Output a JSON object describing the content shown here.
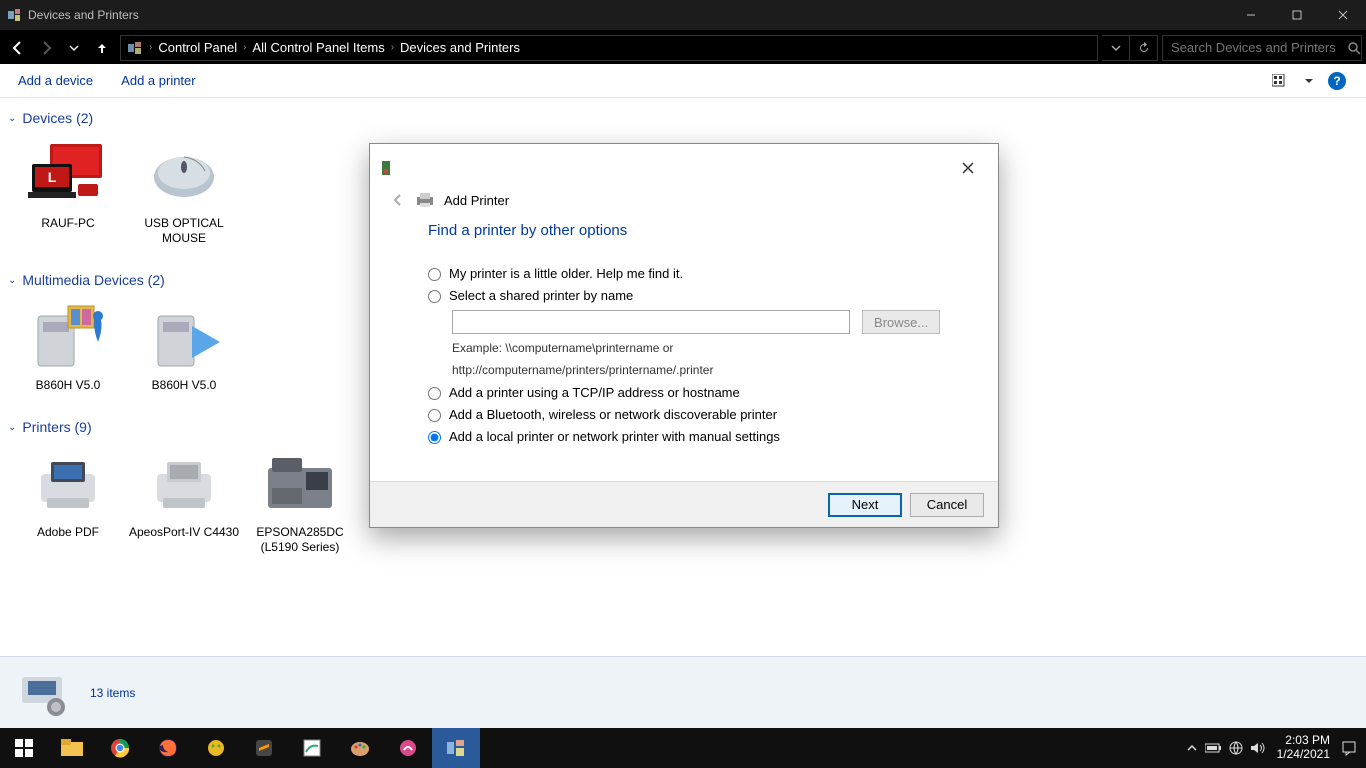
{
  "window": {
    "title": "Devices and Printers"
  },
  "breadcrumb": [
    "Control Panel",
    "All Control Panel Items",
    "Devices and Printers"
  ],
  "search": {
    "placeholder": "Search Devices and Printers"
  },
  "commands": {
    "add_device": "Add a device",
    "add_printer": "Add a printer"
  },
  "sections": [
    {
      "title": "Devices (2)",
      "items": [
        {
          "name": "RAUF-PC",
          "icon": "pc"
        },
        {
          "name": "USB OPTICAL MOUSE",
          "icon": "mouse"
        }
      ]
    },
    {
      "title": "Multimedia Devices (2)",
      "items": [
        {
          "name": "B860H V5.0",
          "icon": "media1"
        },
        {
          "name": "B860H V5.0",
          "icon": "media2"
        }
      ]
    },
    {
      "title": "Printers (9)",
      "items": [
        {
          "name": "Adobe PDF",
          "icon": "printer"
        },
        {
          "name": "ApeosPort-IV C4430",
          "icon": "printer"
        },
        {
          "name": "EPSONA285DC (L5190 Series)",
          "icon": "mfp"
        }
      ]
    }
  ],
  "status": {
    "text": "13 items"
  },
  "dialog": {
    "header": "Add Printer",
    "title": "Find a printer by other options",
    "options": {
      "older": "My printer is a little older. Help me find it.",
      "shared": "Select a shared printer by name",
      "shared_example_1": "Example: \\\\computername\\printername or",
      "shared_example_2": "http://computername/printers/printername/.printer",
      "browse": "Browse...",
      "tcpip": "Add a printer using a TCP/IP address or hostname",
      "bluetooth": "Add a Bluetooth, wireless or network discoverable printer",
      "local": "Add a local printer or network printer with manual settings"
    },
    "buttons": {
      "next": "Next",
      "cancel": "Cancel"
    }
  },
  "taskbar": {
    "time": "2:03 PM",
    "date": "1/24/2021"
  }
}
